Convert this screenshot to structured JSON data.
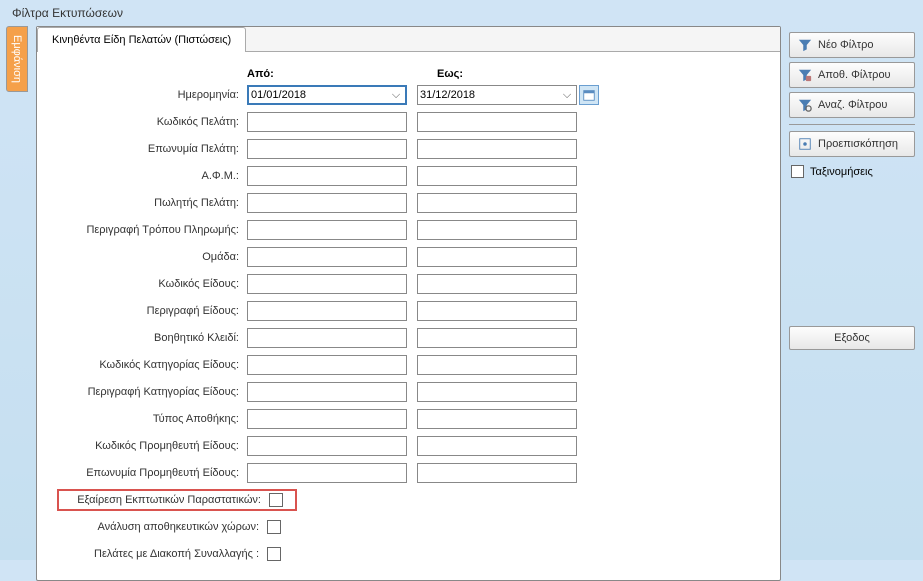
{
  "window_title": "Φίλτρα Εκτυπώσεων",
  "vertical_tab": "Εμφάνιση",
  "tab": {
    "label": "Κινηθέντα Είδη Πελατών (Πιστώσεις)"
  },
  "columns": {
    "from": "Από:",
    "to": "Εως:"
  },
  "rows": [
    {
      "key": "date",
      "label": "Ημερομηνία:",
      "type": "date",
      "from": "01/01/2018",
      "to": "31/12/2018"
    },
    {
      "key": "client_code",
      "label": "Κωδικός Πελάτη:",
      "type": "text",
      "from": "",
      "to": ""
    },
    {
      "key": "client_name",
      "label": "Επωνυμία Πελάτη:",
      "type": "text",
      "from": "",
      "to": ""
    },
    {
      "key": "afm",
      "label": "Α.Φ.Μ.:",
      "type": "text",
      "from": "",
      "to": ""
    },
    {
      "key": "salesman",
      "label": "Πωλητής Πελάτη:",
      "type": "text",
      "from": "",
      "to": ""
    },
    {
      "key": "payment_desc",
      "label": "Περιγραφή Τρόπου Πληρωμής:",
      "type": "text",
      "from": "",
      "to": ""
    },
    {
      "key": "group",
      "label": "Ομάδα:",
      "type": "text",
      "from": "",
      "to": ""
    },
    {
      "key": "item_code",
      "label": "Κωδικός Είδους:",
      "type": "text",
      "from": "",
      "to": ""
    },
    {
      "key": "item_desc",
      "label": "Περιγραφή Είδους:",
      "type": "text",
      "from": "",
      "to": ""
    },
    {
      "key": "aux_key",
      "label": "Βοηθητικό Κλειδί:",
      "type": "text",
      "from": "",
      "to": ""
    },
    {
      "key": "item_cat_code",
      "label": "Κωδικός Κατηγορίας Είδους:",
      "type": "text",
      "from": "",
      "to": ""
    },
    {
      "key": "item_cat_desc",
      "label": "Περιγραφή Κατηγορίας Είδους:",
      "type": "text",
      "from": "",
      "to": ""
    },
    {
      "key": "warehouse_type",
      "label": "Τύπος Αποθήκης:",
      "type": "text",
      "from": "",
      "to": ""
    },
    {
      "key": "supplier_code",
      "label": "Κωδικός Προμηθευτή Είδους:",
      "type": "text",
      "from": "",
      "to": ""
    },
    {
      "key": "supplier_name",
      "label": "Επωνυμία Προμηθευτή Είδους:",
      "type": "text",
      "from": "",
      "to": ""
    }
  ],
  "checkboxes": [
    {
      "key": "exclude_discount",
      "label": "Εξαίρεση Εκπτωτικών Παραστατικών:",
      "highlight": true
    },
    {
      "key": "storage_analysis",
      "label": "Ανάλυση αποθηκευτικών χώρων:",
      "highlight": false
    },
    {
      "key": "clients_stop",
      "label": "Πελάτες με Διακοπή Συναλλαγής :",
      "highlight": false
    }
  ],
  "buttons": {
    "new_filter": "Νέο Φίλτρο",
    "save_filter": "Αποθ. Φίλτρου",
    "search_filter": "Αναζ. Φίλτρου",
    "preview": "Προεπισκόπηση",
    "classifications": "Ταξινομήσεις",
    "exit": "Εξοδος"
  }
}
